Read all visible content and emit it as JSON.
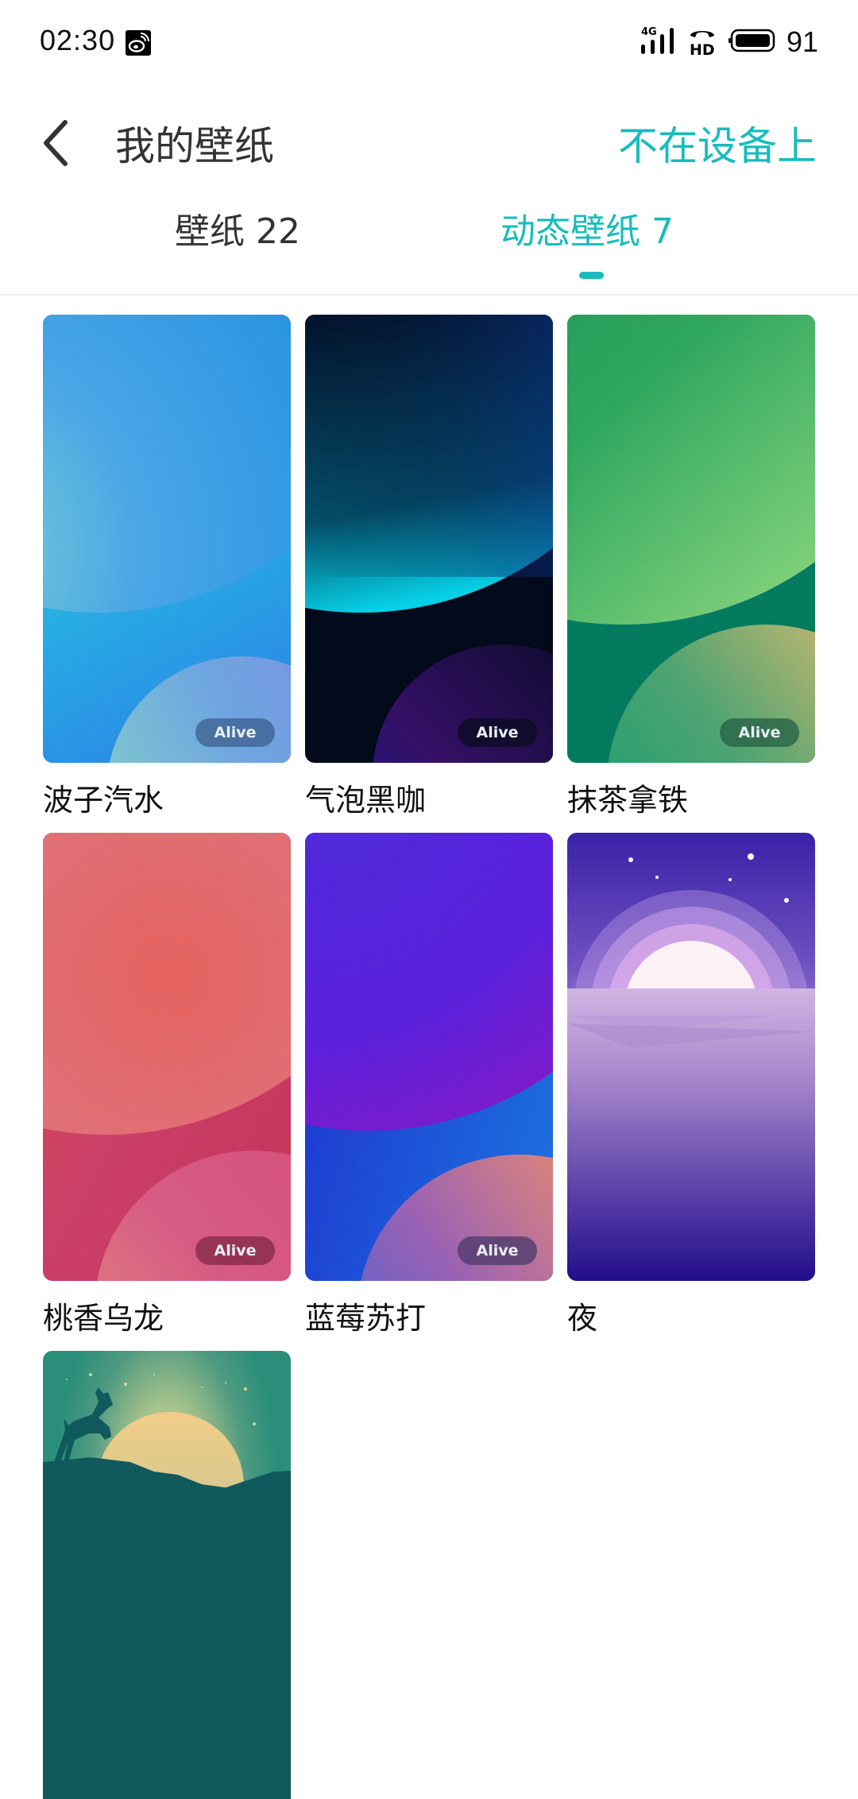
{
  "status_bar": {
    "time": "02:30",
    "notification_icon": "weibo-icon",
    "network_label": "4G",
    "hd_label": "HD",
    "battery_percent": "91"
  },
  "header": {
    "back_icon": "chevron-left-icon",
    "title": "我的壁纸",
    "action_label": "不在设备上"
  },
  "tabs": [
    {
      "label": "壁纸 22",
      "active": false
    },
    {
      "label": "动态壁纸 7",
      "active": true
    }
  ],
  "colors": {
    "accent": "#17bcbc",
    "text_primary": "#333333"
  },
  "wallpapers": [
    {
      "name": "波子汽水",
      "badge": "Alive"
    },
    {
      "name": "气泡黑咖",
      "badge": "Alive"
    },
    {
      "name": "抹茶拿铁",
      "badge": "Alive"
    },
    {
      "name": "桃香乌龙",
      "badge": "Alive"
    },
    {
      "name": "蓝莓苏打",
      "badge": "Alive"
    },
    {
      "name": "夜",
      "badge": null
    },
    {
      "name": "",
      "badge": null
    }
  ]
}
